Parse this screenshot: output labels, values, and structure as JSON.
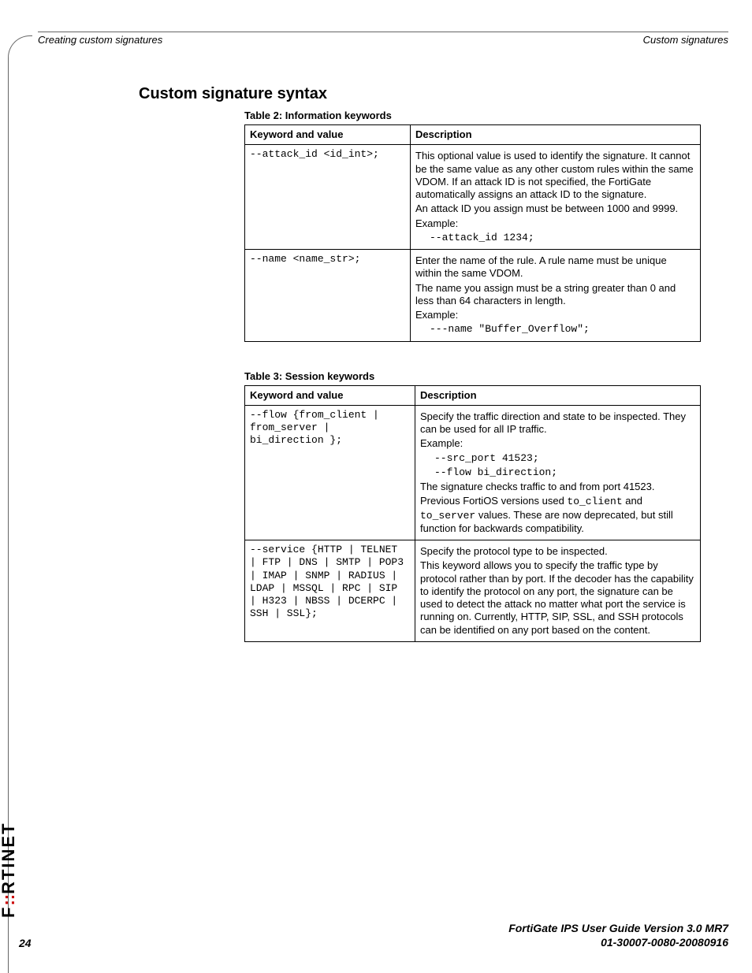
{
  "header": {
    "left": "Creating custom signatures",
    "right": "Custom signatures"
  },
  "section_title": "Custom signature syntax",
  "table2": {
    "caption": "Table 2: Information keywords",
    "head": {
      "c1": "Keyword and value",
      "c2": "Description"
    },
    "rows": [
      {
        "kv": "--attack_id <id_int>;",
        "desc": {
          "p1": "This optional value is used to identify the signature. It cannot be the same value as any other custom rules within the same VDOM. If an attack ID is not specified, the FortiGate automatically assigns an attack ID to the signature.",
          "p2": "An attack ID you assign must be between 1000 and 9999.",
          "p3": "Example:",
          "ex": "--attack_id 1234;"
        }
      },
      {
        "kv": "--name <name_str>;",
        "desc": {
          "p1": "Enter the name of the rule. A rule name must be unique within the same VDOM.",
          "p2": "The name you assign must be a string greater than 0 and less than 64 characters in length.",
          "p3": "Example:",
          "ex": "---name \"Buffer_Overflow\";"
        }
      }
    ]
  },
  "table3": {
    "caption": "Table 3: Session keywords",
    "head": {
      "c1": "Keyword and value",
      "c2": "Description"
    },
    "rows": [
      {
        "kv": "--flow {from_client |\nfrom_server |\nbi_direction };",
        "desc": {
          "p1": "Specify the traffic direction and state to be inspected. They can be used for all IP traffic.",
          "p2": "Example:",
          "ex1": "--src_port 41523;",
          "ex2": "--flow bi_direction;",
          "p3a": "The signature checks traffic to and from port 41523.",
          "p3b_pre": "Previous FortiOS versions used ",
          "p3b_c1": "to_client",
          "p3b_mid": " and ",
          "p3b_c2": "to_server",
          "p3b_post": " values. These are now deprecated, but still function for backwards compatibility."
        }
      },
      {
        "kv": "--service {HTTP | TELNET\n| FTP | DNS | SMTP | POP3\n| IMAP | SNMP | RADIUS |\nLDAP | MSSQL | RPC | SIP\n| H323 | NBSS | DCERPC |\nSSH | SSL};",
        "desc": {
          "p1": "Specify the protocol type to be inspected.",
          "p2": "This keyword allows you to specify the traffic type by protocol rather than by port. If the decoder has the capability to identify the protocol on any port, the signature can be used to detect the attack no matter what port the service is running on. Currently, HTTP, SIP, SSL, and SSH protocols can be identified on any port based on the content."
        }
      }
    ]
  },
  "footer": {
    "line1": "FortiGate IPS User Guide Version 3.0 MR7",
    "line2": "01-30007-0080-20080916",
    "page": "24"
  },
  "logo": {
    "pre": "F",
    "accent": "::",
    "post": "RTINET"
  }
}
